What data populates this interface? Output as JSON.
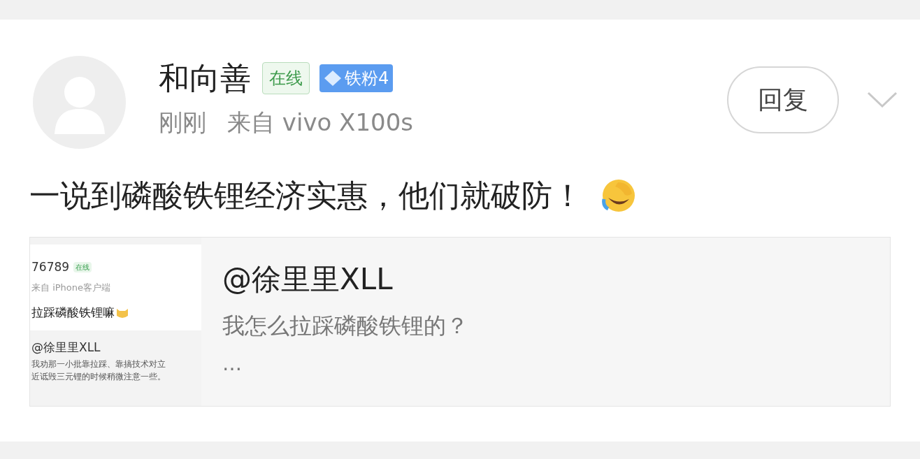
{
  "post": {
    "author": {
      "name": "和向善",
      "badges": [
        {
          "kind": "online",
          "label": "在线"
        },
        {
          "kind": "fan",
          "label": "铁粉4"
        }
      ]
    },
    "time": "刚刚",
    "source": "来自 vivo X100s",
    "reply_button": "回复",
    "text": "一说到磷酸铁锂经济实惠，他们就破防！",
    "quote": {
      "author": "@徐里里XLL",
      "text": "我怎么拉踩磷酸铁锂的？",
      "more": "…",
      "thumbnail": {
        "name": "76789",
        "badge": "在线",
        "source": "来自 iPhone客户端",
        "text": "拉踩磷酸铁锂嘛",
        "quote_author": "@徐里里XLL",
        "quote_lines": [
          "我劝那一小批靠拉踩、靠搞技术对立",
          "近诋毁三元锂的时候稍微注意一些。"
        ]
      }
    }
  }
}
